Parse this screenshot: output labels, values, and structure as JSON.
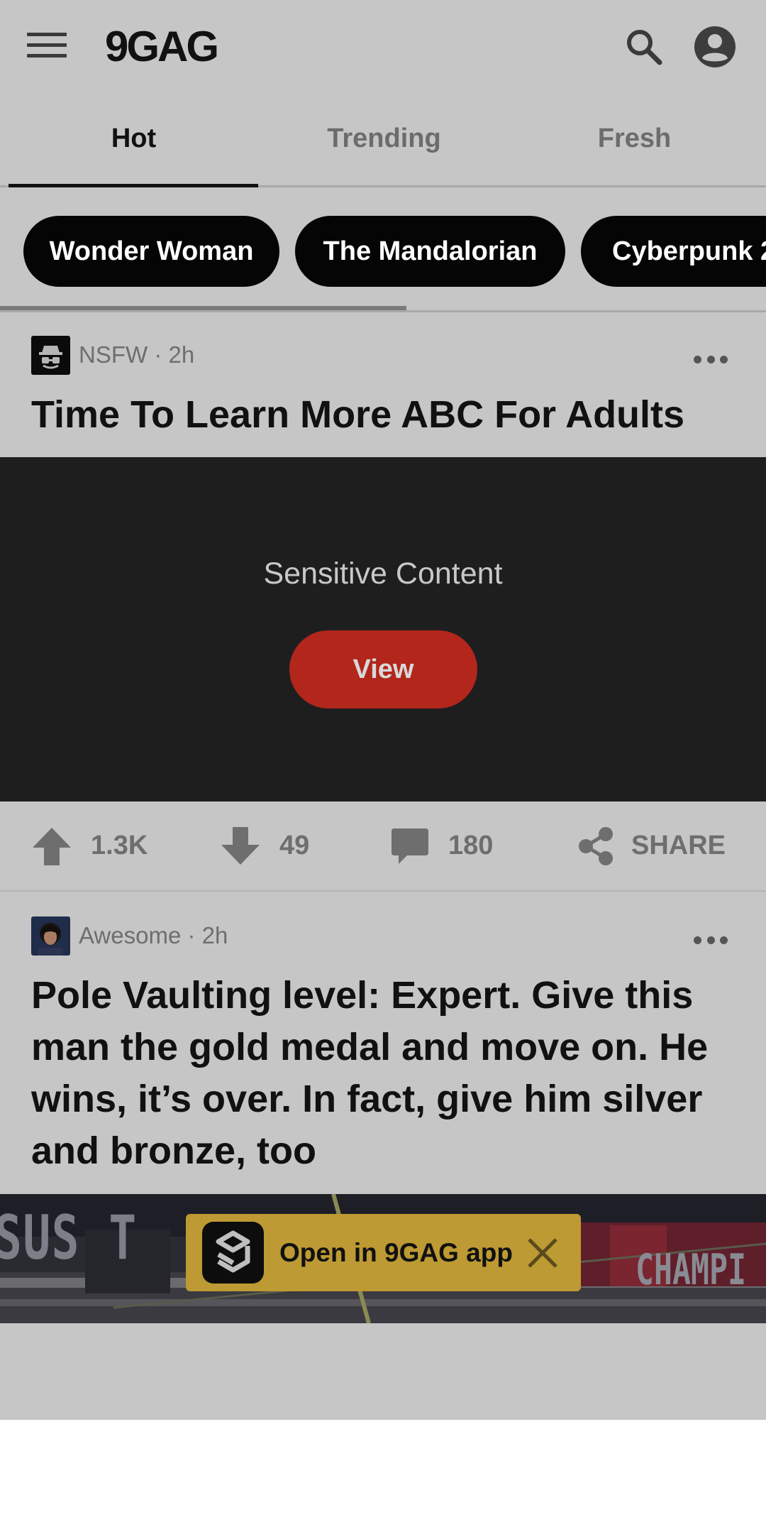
{
  "header": {
    "logo": "9GAG",
    "menu_icon": "hamburger-menu-icon",
    "search_icon": "search-icon",
    "profile_icon": "user-profile-icon"
  },
  "tabs": [
    {
      "label": "Hot",
      "active": true
    },
    {
      "label": "Trending",
      "active": false
    },
    {
      "label": "Fresh",
      "active": false
    }
  ],
  "chips": [
    {
      "label": "Wonder Woman"
    },
    {
      "label": "The Mandalorian"
    },
    {
      "label": "Cyberpunk 2"
    }
  ],
  "posts": [
    {
      "section": "NSFW",
      "age": "2h",
      "meta": "NSFW · 2h",
      "title": "Time To Learn More ABC For Adults",
      "sensitive_label": "Sensitive Content",
      "view_label": "View",
      "upvotes": "1.3K",
      "downvotes": "49",
      "comments": "180",
      "share_label": "SHARE"
    },
    {
      "section": "Awesome",
      "age": "2h",
      "meta": "Awesome · 2h",
      "title_lines": [
        "Pole Vaulting level: Expert. Give this",
        "man the gold medal and move on. He",
        "wins, it’s over. In fact, give him silver",
        "and bronze, too"
      ],
      "media_text": [
        "SUS T",
        "CHAMPI"
      ]
    }
  ],
  "open_app_banner": {
    "label": "Open in 9GAG app",
    "app_icon": "9gag-app-icon",
    "close_icon": "close-icon"
  },
  "colors": {
    "page_background": "#c6c6c6",
    "sensitive_background": "#1e1e1f",
    "view_button": "#b2261c",
    "chip_background": "#050505",
    "banner_background": "#bd9a33"
  }
}
